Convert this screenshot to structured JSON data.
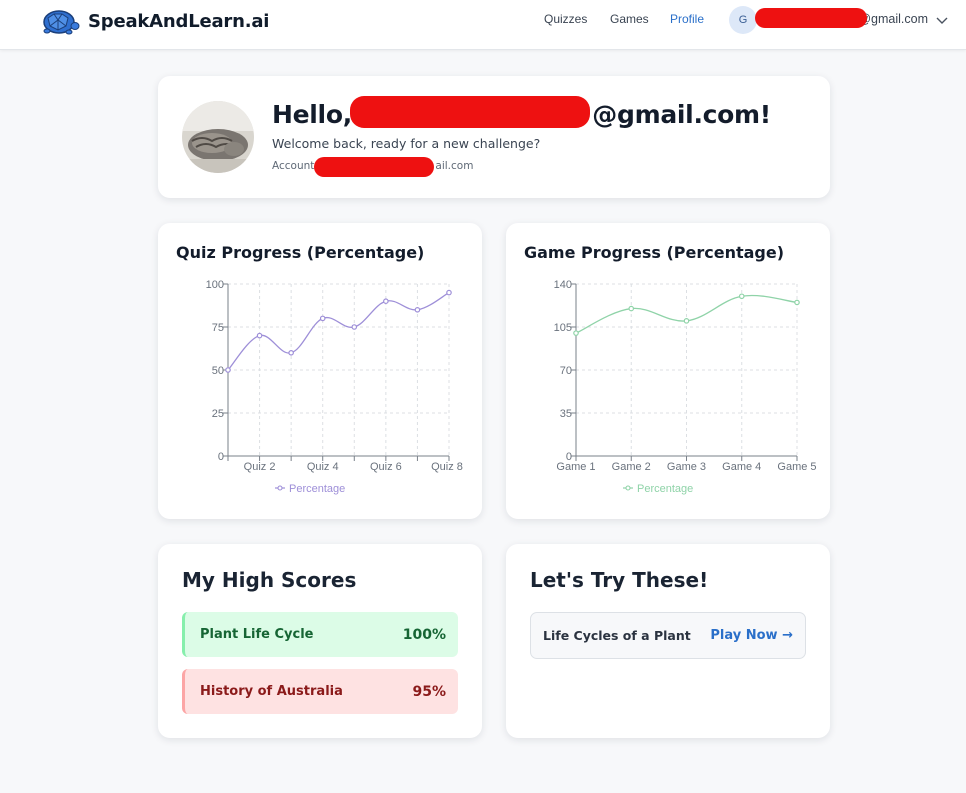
{
  "header": {
    "brand": "SpeakAndLearn.ai",
    "nav": {
      "quizzes": "Quizzes",
      "games": "Games",
      "profile": "Profile"
    },
    "user_initial": "G",
    "user_email": "gmail.com",
    "user_email_visible_suffix": "@gmail.com"
  },
  "hello": {
    "title_prefix": "Hello, ",
    "title_suffix": "@gmail.com!",
    "subtitle": "Welcome back, ready for a new challenge?",
    "account_prefix": "Account",
    "account_suffix": "ail.com"
  },
  "quiz_chart": {
    "title": "Quiz Progress (Percentage)",
    "legend": "Percentage",
    "color": "#9e8fd8"
  },
  "game_chart": {
    "title": "Game Progress (Percentage)",
    "legend": "Percentage",
    "color": "#8fd3a8"
  },
  "chart_data": [
    {
      "type": "line",
      "title": "Quiz Progress (Percentage)",
      "x": [
        "Quiz 1",
        "Quiz 2",
        "Quiz 3",
        "Quiz 4",
        "Quiz 5",
        "Quiz 6",
        "Quiz 7",
        "Quiz 8"
      ],
      "x_tick_labels_shown": [
        "Quiz 2",
        "Quiz 4",
        "Quiz 6",
        "Quiz 8"
      ],
      "series": [
        {
          "name": "Percentage",
          "values": [
            50,
            70,
            60,
            80,
            75,
            90,
            85,
            95
          ]
        }
      ],
      "yticks": [
        0,
        25,
        50,
        75,
        100
      ],
      "ylim": [
        0,
        100
      ],
      "grid": true,
      "legend_position": "bottom"
    },
    {
      "type": "line",
      "title": "Game Progress (Percentage)",
      "x": [
        "Game 1",
        "Game 2",
        "Game 3",
        "Game 4",
        "Game 5"
      ],
      "x_tick_labels_shown": [
        "Game 1",
        "Game 2",
        "Game 3",
        "Game 4",
        "Game 5"
      ],
      "series": [
        {
          "name": "Percentage",
          "values": [
            100,
            120,
            110,
            130,
            125
          ]
        }
      ],
      "yticks": [
        0,
        35,
        70,
        105,
        140
      ],
      "ylim": [
        0,
        140
      ],
      "grid": true,
      "legend_position": "bottom"
    }
  ],
  "high_scores": {
    "title": "My High Scores",
    "items": [
      {
        "name": "Plant Life Cycle",
        "score": "100%"
      },
      {
        "name": "History of Australia",
        "score": "95%"
      }
    ]
  },
  "try_these": {
    "title": "Let's Try These!",
    "items": [
      {
        "name": "Life Cycles of a Plant",
        "action": "Play Now →"
      }
    ]
  }
}
